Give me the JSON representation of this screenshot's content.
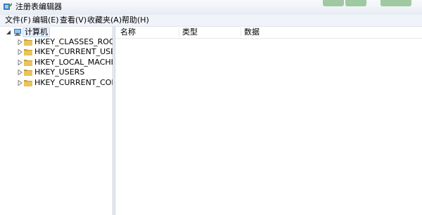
{
  "window": {
    "title": "注册表编辑器",
    "icon": "regedit-icon"
  },
  "menu": [
    {
      "label": "文件(F)"
    },
    {
      "label": "编辑(E)"
    },
    {
      "label": "查看(V)"
    },
    {
      "label": "收藏夹(A)"
    },
    {
      "label": "帮助(H)"
    }
  ],
  "tree": {
    "root": {
      "label": "计算机",
      "icon": "computer-icon",
      "expanded": true
    },
    "children": [
      {
        "label": "HKEY_CLASSES_ROOT",
        "icon": "folder-icon"
      },
      {
        "label": "HKEY_CURRENT_USER",
        "icon": "folder-icon"
      },
      {
        "label": "HKEY_LOCAL_MACHINE",
        "icon": "folder-icon"
      },
      {
        "label": "HKEY_USERS",
        "icon": "folder-icon"
      },
      {
        "label": "HKEY_CURRENT_CONFIG",
        "icon": "folder-icon"
      }
    ]
  },
  "list": {
    "columns": [
      {
        "label": "名称"
      },
      {
        "label": "类型"
      },
      {
        "label": "数据"
      }
    ],
    "rows": []
  },
  "colors": {
    "folder": "#e8c55a",
    "folder_dark": "#c89a2a",
    "titlebar_buttons": "#8fc18f"
  }
}
